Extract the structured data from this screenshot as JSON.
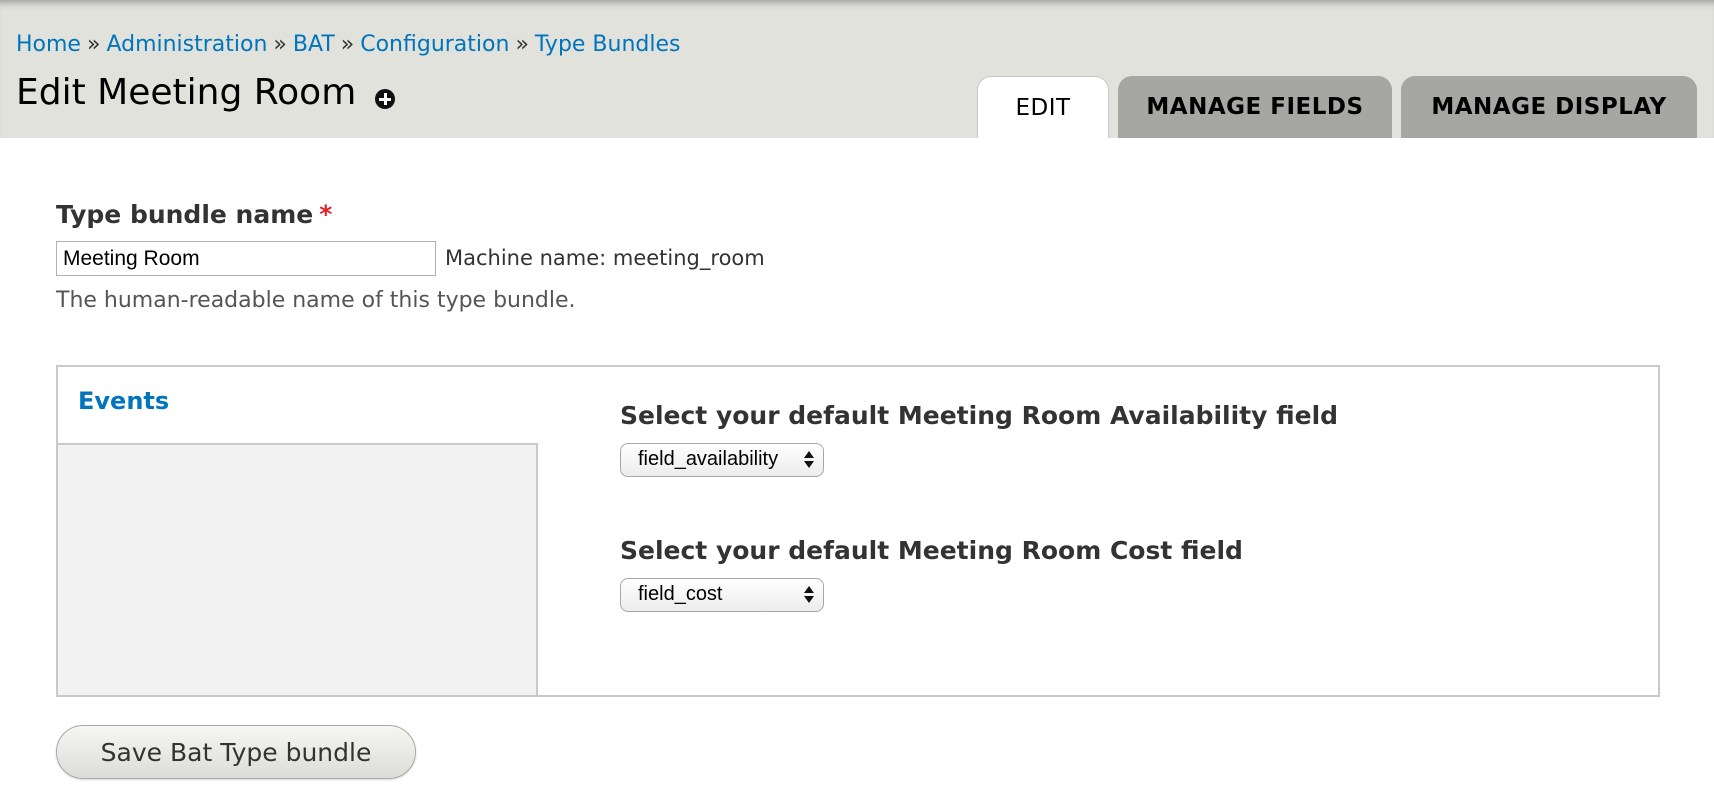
{
  "breadcrumb": {
    "items": [
      "Home",
      "Administration",
      "BAT",
      "Configuration",
      "Type Bundles"
    ],
    "separator": "»"
  },
  "page": {
    "title": "Edit Meeting Room",
    "shortcut_icon": "plus-circle-icon"
  },
  "tabs": [
    {
      "label": "EDIT",
      "active": true
    },
    {
      "label": "MANAGE FIELDS",
      "active": false
    },
    {
      "label": "MANAGE DISPLAY",
      "active": false
    }
  ],
  "form": {
    "name_label": "Type bundle name",
    "required_marker": "*",
    "name_value": "Meeting Room",
    "machine_name": "Machine name: meeting_room",
    "name_description": "The human-readable name of this type bundle.",
    "vertical_tab": "Events",
    "availability_label": "Select your default Meeting Room Availability field",
    "availability_value": "field_availability",
    "cost_label": "Select your default Meeting Room Cost field",
    "cost_value": "field_cost",
    "save_label": "Save Bat Type bundle"
  },
  "colors": {
    "link": "#0074bd",
    "header_bg": "#e1e2dc",
    "inactive_tab": "#a6a7a2",
    "required": "#e0242a"
  }
}
